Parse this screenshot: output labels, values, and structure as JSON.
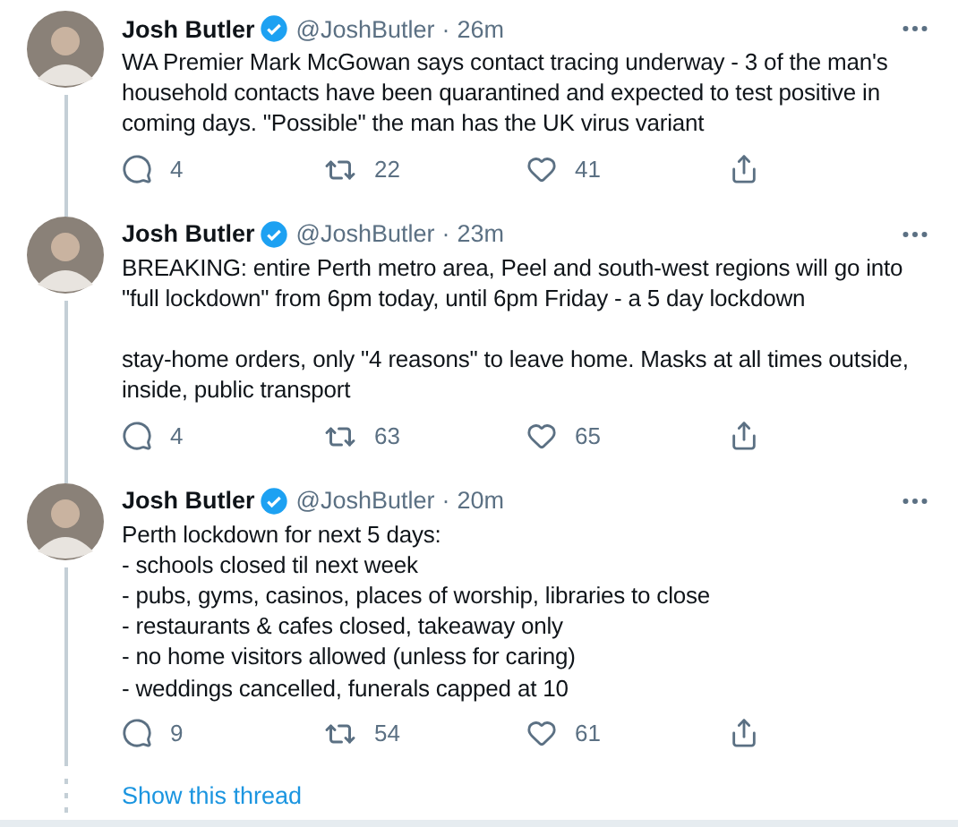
{
  "tweets": [
    {
      "name": "Josh Butler",
      "verified": true,
      "handle": "@JoshButler",
      "separator": "·",
      "time": "26m",
      "text": "WA Premier Mark McGowan says contact tracing underway - 3 of the man's household contacts have been quarantined and expected to test positive in coming days. \"Possible\" the man has the UK virus variant",
      "replies": "4",
      "retweets": "22",
      "likes": "41",
      "thread_below": true
    },
    {
      "name": "Josh Butler",
      "verified": true,
      "handle": "@JoshButler",
      "separator": "·",
      "time": "23m",
      "text": "BREAKING: entire Perth metro area, Peel and south-west regions will go into \"full lockdown\" from 6pm today, until 6pm Friday - a 5 day lockdown\n\nstay-home orders, only \"4 reasons\" to leave home. Masks at all times outside, inside, public transport",
      "replies": "4",
      "retweets": "63",
      "likes": "65",
      "thread_below": true
    },
    {
      "name": "Josh Butler",
      "verified": true,
      "handle": "@JoshButler",
      "separator": "·",
      "time": "20m",
      "text": "Perth lockdown for next 5 days:\n- schools closed til next week\n- pubs, gyms, casinos, places of worship, libraries to close\n- restaurants & cafes closed, takeaway only\n- no home visitors allowed (unless for caring)\n- weddings cancelled, funerals capped at 10",
      "replies": "9",
      "retweets": "54",
      "likes": "61",
      "thread_below": true
    }
  ],
  "show_thread": "Show this thread"
}
